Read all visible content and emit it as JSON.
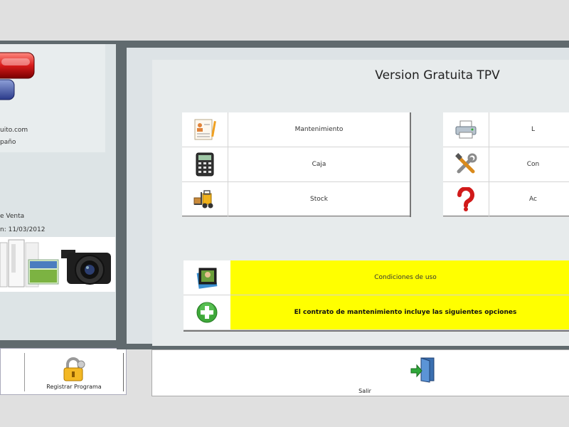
{
  "left_panel": {
    "website_fragment": "uito.com",
    "country_fragment": "paño",
    "sale_fragment": "e Venta",
    "date_fragment": "n:  11/03/2012",
    "register_button_label": "Registrar Programa"
  },
  "main": {
    "title": "Version Gratuita TPV",
    "menu_left": [
      {
        "label": "Mantenimiento",
        "icon": "document-form-icon"
      },
      {
        "label": "Caja",
        "icon": "calculator-icon"
      },
      {
        "label": "Stock",
        "icon": "forklift-icon"
      }
    ],
    "menu_right": [
      {
        "label": "L",
        "icon": "printer-icon"
      },
      {
        "label": "Con",
        "icon": "tools-icon"
      },
      {
        "label": "Ac",
        "icon": "question-mark-icon"
      }
    ],
    "info_rows": [
      {
        "label": "Condiciones de uso",
        "icon": "photo-frame-icon"
      },
      {
        "label": "El contrato de mantenimiento incluye las siguientes opciones",
        "icon": "green-plus-icon"
      }
    ],
    "exit_label": "Salir"
  },
  "colors": {
    "highlight": "#ffff00",
    "frame": "#606a6e",
    "panel": "#dde3e6"
  }
}
